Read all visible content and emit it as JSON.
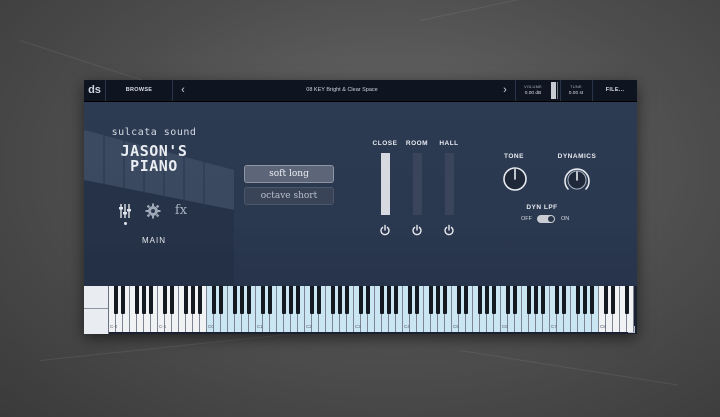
{
  "topbar": {
    "logo": "ds",
    "browse_label": "BROWSE",
    "prev_label": "‹",
    "next_label": "›",
    "preset_name": "08 KEY Bright & Clear Space",
    "volume_label": "VOLUME",
    "volume_value": "0.00 dB",
    "tune_label": "TUNE",
    "tune_value": "0.00 st",
    "file_label": "FILE..."
  },
  "brand": {
    "company": "sulcata sound",
    "product_line1": "JASON'S",
    "product_line2": "PIANO"
  },
  "main_nav": {
    "mixer_icon": "sliders-icon",
    "settings_icon": "gear-icon",
    "fx_label": "fx",
    "main_label": "MAIN"
  },
  "articulations": [
    {
      "label": "soft long",
      "active": true
    },
    {
      "label": "octave short",
      "active": false
    }
  ],
  "mics": [
    {
      "label": "CLOSE",
      "level": 1.0,
      "power_icon": "power-icon"
    },
    {
      "label": "ROOM",
      "level": 0.0,
      "power_icon": "power-icon"
    },
    {
      "label": "HALL",
      "level": 0.0,
      "power_icon": "power-icon"
    }
  ],
  "knobs": [
    {
      "label": "TONE",
      "value": 0.5
    },
    {
      "label": "DYNAMICS",
      "value": 0.5
    }
  ],
  "dyn_lpf": {
    "label": "DYN LPF",
    "off_label": "OFF",
    "on_label": "ON",
    "state": "on"
  },
  "keyboard": {
    "octave_labels": [
      "C-2",
      "C-1",
      "C0",
      "C1",
      "C2",
      "C3",
      "C4",
      "C5",
      "C6",
      "C7",
      "C8"
    ],
    "active_range_label": "C0 – C7"
  },
  "colors": {
    "panel": "#2a3850",
    "topbar": "#0e1420",
    "range_key": "#c9e6f2",
    "text": "#e7eaef"
  }
}
